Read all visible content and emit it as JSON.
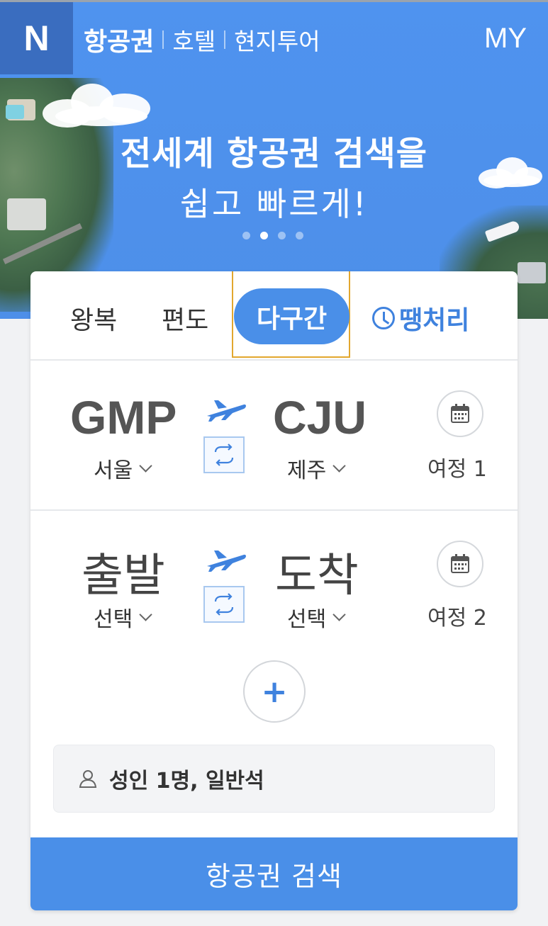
{
  "header": {
    "logo": "N",
    "nav": [
      "항공권",
      "호텔",
      "현지투어"
    ],
    "my": "MY"
  },
  "banner": {
    "headline": "전세계 항공권 검색을",
    "subline": "쉽고 빠르게!",
    "slide_count": 4,
    "active_slide": 2
  },
  "tabs": {
    "round_trip": "왕복",
    "one_way": "편도",
    "multi_city": "다구간",
    "last_minute": "땡처리",
    "selected": "다구간"
  },
  "legs": [
    {
      "from_code": "GMP",
      "from_city": "서울",
      "to_code": "CJU",
      "to_city": "제주",
      "label": "여정 1"
    },
    {
      "from_code": "출발",
      "from_city": "선택",
      "to_code": "도착",
      "to_city": "선택",
      "label": "여정 2"
    }
  ],
  "add_leg": "+",
  "passengers": "성인 1명, 일반석",
  "search_button": "항공권 검색",
  "colors": {
    "primary": "#4a8fe8",
    "hero": "#4f93ef",
    "highlight_border": "#e2a72e"
  }
}
